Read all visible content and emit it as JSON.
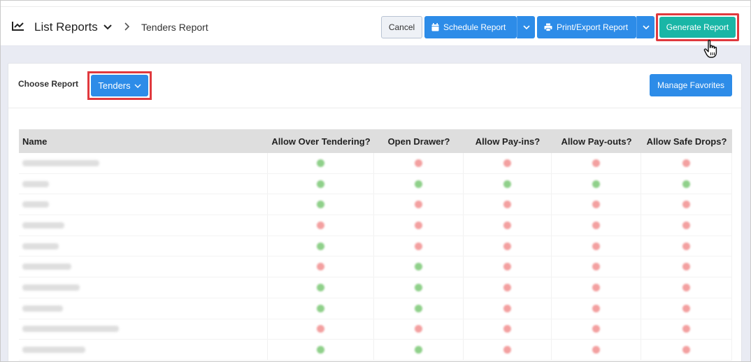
{
  "header": {
    "breadcrumb_title": "List Reports",
    "breadcrumb_current": "Tenders Report",
    "cancel_label": "Cancel",
    "schedule_label": "Schedule Report",
    "print_label": "Print/Export Report",
    "generate_label": "Generate Report"
  },
  "report": {
    "choose_label": "Choose Report",
    "selected_report": "Tenders",
    "manage_favorites_label": "Manage Favorites"
  },
  "table": {
    "columns": [
      "Name",
      "Allow Over Tendering?",
      "Open Drawer?",
      "Allow Pay-ins?",
      "Allow Pay-outs?",
      "Allow Safe Drops?"
    ],
    "rows": [
      {
        "name_blurred": true,
        "flags": [
          true,
          false,
          false,
          false,
          false
        ]
      },
      {
        "name_blurred": true,
        "flags": [
          true,
          true,
          true,
          true,
          true
        ]
      },
      {
        "name_blurred": true,
        "flags": [
          true,
          false,
          false,
          false,
          false
        ]
      },
      {
        "name_blurred": true,
        "flags": [
          false,
          false,
          false,
          false,
          false
        ]
      },
      {
        "name_blurred": true,
        "flags": [
          true,
          false,
          false,
          false,
          false
        ]
      },
      {
        "name_blurred": true,
        "flags": [
          false,
          true,
          false,
          false,
          false
        ]
      },
      {
        "name_blurred": true,
        "flags": [
          true,
          true,
          false,
          false,
          false
        ]
      },
      {
        "name_blurred": true,
        "flags": [
          true,
          true,
          false,
          false,
          false
        ]
      },
      {
        "name_blurred": true,
        "flags": [
          false,
          false,
          false,
          false,
          false
        ]
      },
      {
        "name_blurred": true,
        "flags": [
          true,
          true,
          false,
          false,
          false
        ]
      }
    ]
  },
  "colors": {
    "primary_blue": "#2d8ce8",
    "generate_teal": "#19b6a6",
    "highlight_red": "#e0393e",
    "yes_green": "#8fd08a",
    "no_red": "#f3a0a0"
  },
  "icons": [
    "chart-line-icon",
    "chevron-down-icon",
    "chevron-right-icon",
    "calendar-icon",
    "printer-icon",
    "hand-pointer-icon"
  ]
}
